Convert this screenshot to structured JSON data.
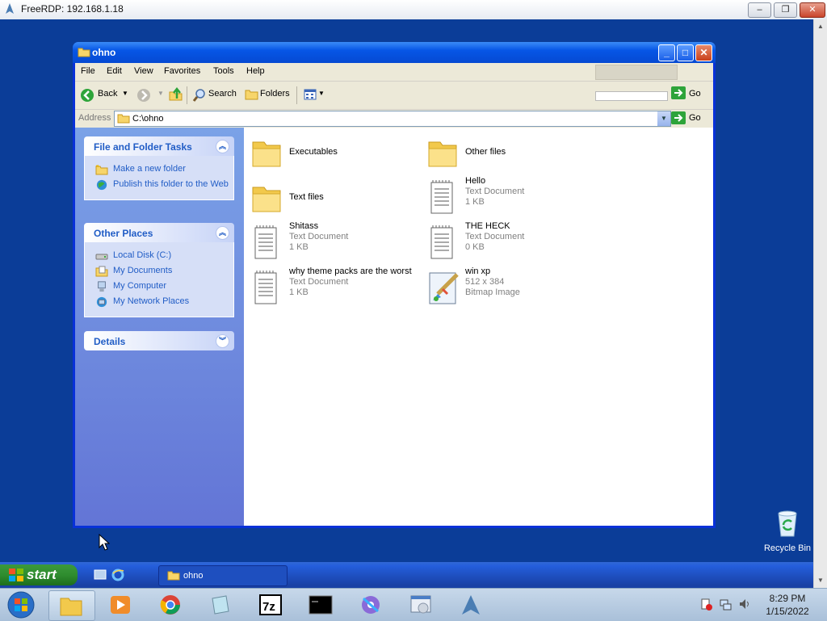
{
  "rdp": {
    "title": "FreeRDP: 192.168.1.18",
    "minimize_label": "–",
    "restore_label": "❐",
    "close_label": "✕"
  },
  "desktop": {
    "recycle_bin_label": "Recycle Bin"
  },
  "explorer": {
    "title": "ohno",
    "menu": [
      "File",
      "Edit",
      "View",
      "Favorites",
      "Tools",
      "Help"
    ],
    "toolbar": {
      "back_label": "Back",
      "search_label": "Search",
      "folders_label": "Folders"
    },
    "address": {
      "label": "Address",
      "value": "C:\\ohno",
      "go_label": "Go",
      "go_label_top": "Go"
    },
    "file_tasks": {
      "title": "File and Folder Tasks",
      "items": [
        "Make a new folder",
        "Publish this folder to the Web"
      ]
    },
    "other_places": {
      "title": "Other Places",
      "items": [
        "Local Disk (C:)",
        "My Documents",
        "My Computer",
        "My Network Places"
      ]
    },
    "details": {
      "title": "Details"
    },
    "files": [
      {
        "name": "Executables",
        "type": "",
        "size": "",
        "icon": "folder-icon"
      },
      {
        "name": "Other files",
        "type": "",
        "size": "",
        "icon": "folder-icon"
      },
      {
        "name": "Text files",
        "type": "",
        "size": "",
        "icon": "folder-icon"
      },
      {
        "name": "Hello",
        "type": "Text Document",
        "size": "1 KB",
        "icon": "text-document-icon"
      },
      {
        "name": "Shitass",
        "type": "Text Document",
        "size": "1 KB",
        "icon": "text-document-icon"
      },
      {
        "name": "THE HECK",
        "type": "Text Document",
        "size": "0 KB",
        "icon": "text-document-icon"
      },
      {
        "name": "why theme packs are the worst",
        "type": "Text Document",
        "size": "1 KB",
        "icon": "text-document-icon"
      },
      {
        "name": "win xp",
        "type": "512 x 384",
        "size": "Bitmap Image",
        "icon": "bitmap-image-icon"
      }
    ]
  },
  "xp_taskbar": {
    "start_label": "start",
    "task_label": "ohno"
  },
  "host_taskbar": {
    "time": "8:29 PM",
    "date": "1/15/2022"
  },
  "colors": {
    "xp_blue": "#0831d9",
    "desktop": "#0b3d98",
    "task_link": "#215dc6",
    "start_green": "#2f8d2f"
  }
}
